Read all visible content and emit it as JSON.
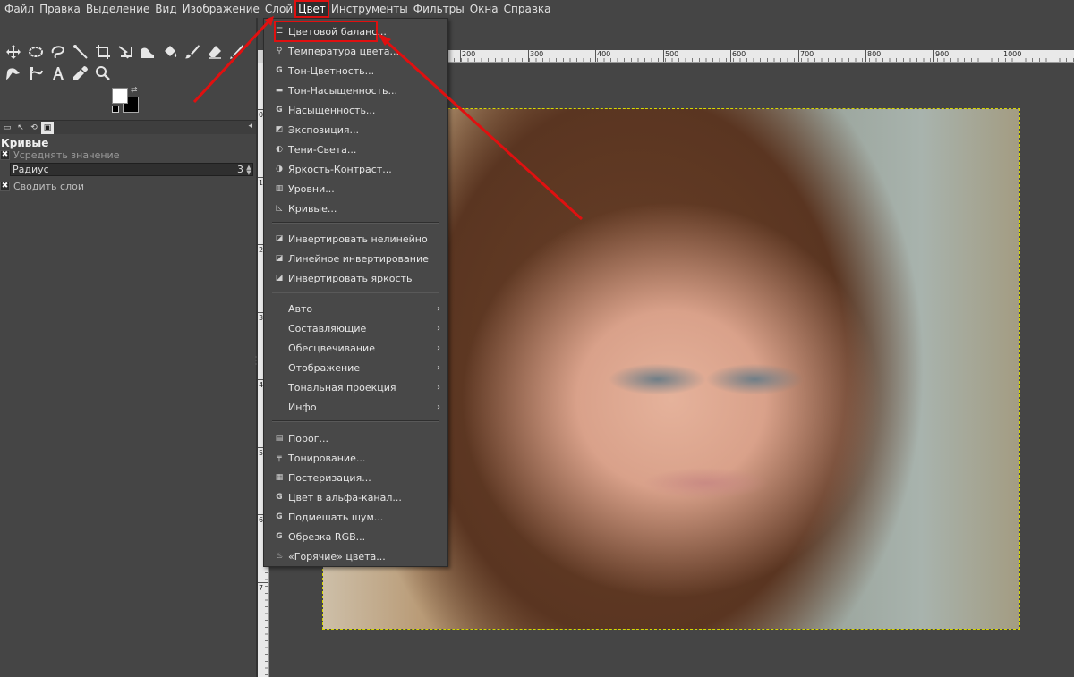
{
  "menubar": {
    "items": [
      "Файл",
      "Правка",
      "Выделение",
      "Вид",
      "Изображение",
      "Слой",
      "Цвет",
      "Инструменты",
      "Фильтры",
      "Окна",
      "Справка"
    ],
    "active_index": 6
  },
  "tool_options": {
    "title": "Кривые",
    "sample_average": "Усреднять значение",
    "radius_label": "Радиус",
    "radius_value": "3",
    "sample_merged": "Сводить слои"
  },
  "rulers": {
    "top": [
      "200",
      "300",
      "400",
      "500",
      "600",
      "700",
      "800",
      "900",
      "1000"
    ],
    "left": [
      "0",
      "1",
      "2",
      "3",
      "4",
      "5",
      "6",
      "7"
    ]
  },
  "color_menu": {
    "items": [
      {
        "label": "Цветовой баланс...",
        "icon": "color-balance-icon",
        "highlighted": true
      },
      {
        "label": "Температура цвета...",
        "icon": "temperature-icon"
      },
      {
        "label": "Тон-Цветность...",
        "icon": "gegl-icon"
      },
      {
        "label": "Тон-Насыщенность...",
        "icon": "hue-saturation-icon"
      },
      {
        "label": "Насыщенность...",
        "icon": "gegl-icon"
      },
      {
        "label": "Экспозиция...",
        "icon": "exposure-icon"
      },
      {
        "label": "Тени-Света...",
        "icon": "shadows-highlights-icon"
      },
      {
        "label": "Яркость-Контраст...",
        "icon": "brightness-contrast-icon"
      },
      {
        "label": "Уровни...",
        "icon": "levels-icon"
      },
      {
        "label": "Кривые...",
        "icon": "curves-icon"
      },
      {
        "label": "Инвертировать нелинейно",
        "icon": "invert-icon"
      },
      {
        "label": "Линейное инвертирование",
        "icon": "invert-icon"
      },
      {
        "label": "Инвертировать яркость",
        "icon": "invert-icon"
      },
      {
        "label": "Авто",
        "submenu": true
      },
      {
        "label": "Составляющие",
        "submenu": true
      },
      {
        "label": "Обесцвечивание",
        "submenu": true
      },
      {
        "label": "Отображение",
        "submenu": true
      },
      {
        "label": "Тональная проекция",
        "submenu": true
      },
      {
        "label": "Инфо",
        "submenu": true
      },
      {
        "label": "Порог...",
        "icon": "threshold-icon"
      },
      {
        "label": "Тонирование...",
        "icon": "colorize-icon"
      },
      {
        "label": "Постеризация...",
        "icon": "posterize-icon"
      },
      {
        "label": "Цвет в альфа-канал...",
        "icon": "gegl-icon"
      },
      {
        "label": "Подмешать шум...",
        "icon": "gegl-icon"
      },
      {
        "label": "Обрезка RGB...",
        "icon": "gegl-icon"
      },
      {
        "label": "«Горячие» цвета...",
        "icon": "hot-colors-icon"
      }
    ]
  },
  "colors": {
    "annotation_red": "#e01010",
    "selection_dash": "#d8d800",
    "ui_background": "#454545"
  }
}
